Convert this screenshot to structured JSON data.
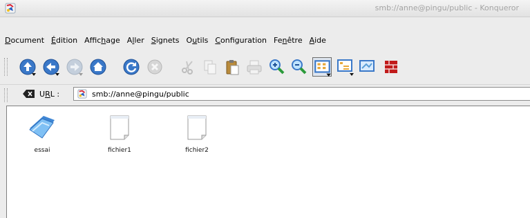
{
  "window": {
    "title": "smb://anne@pingu/public - Konqueror"
  },
  "menubar": {
    "items": [
      {
        "pre": "",
        "u": "D",
        "post": "ocument"
      },
      {
        "pre": "",
        "u": "É",
        "post": "dition"
      },
      {
        "pre": "Affic",
        "u": "h",
        "post": "age"
      },
      {
        "pre": "A",
        "u": "l",
        "post": "ler"
      },
      {
        "pre": "",
        "u": "S",
        "post": "ignets"
      },
      {
        "pre": "O",
        "u": "u",
        "post": "tils"
      },
      {
        "pre": "",
        "u": "C",
        "post": "onfiguration"
      },
      {
        "pre": "Fe",
        "u": "n",
        "post": "être"
      },
      {
        "pre": "",
        "u": "A",
        "post": "ide"
      }
    ]
  },
  "toolbar": {
    "buttons": [
      {
        "icon": "up-arrow-icon",
        "enabled": true
      },
      {
        "icon": "back-arrow-icon",
        "enabled": true
      },
      {
        "icon": "forward-arrow-icon",
        "enabled": false
      },
      {
        "icon": "home-icon",
        "enabled": true
      },
      {
        "icon": "reload-icon",
        "enabled": true
      },
      {
        "icon": "stop-icon",
        "enabled": false
      },
      {
        "icon": "cut-icon",
        "enabled": false
      },
      {
        "icon": "copy-icon",
        "enabled": false
      },
      {
        "icon": "paste-icon",
        "enabled": true
      },
      {
        "icon": "print-icon",
        "enabled": false
      },
      {
        "icon": "zoom-in-icon",
        "enabled": true
      },
      {
        "icon": "zoom-out-icon",
        "enabled": true
      },
      {
        "icon": "icon-view-icon",
        "enabled": true,
        "active": true
      },
      {
        "icon": "tree-view-icon",
        "enabled": true
      },
      {
        "icon": "preview-icon",
        "enabled": true
      },
      {
        "icon": "security-icon",
        "enabled": true
      }
    ]
  },
  "location": {
    "label_pre": "U",
    "label_u": "R",
    "label_post": "L :",
    "url": "smb://anne@pingu/public"
  },
  "files": [
    {
      "name": "essai",
      "type": "folder"
    },
    {
      "name": "fichier1",
      "type": "file"
    },
    {
      "name": "fichier2",
      "type": "file"
    }
  ],
  "colors": {
    "accent_blue": "#3a78c8",
    "folder_blue": "#5ea7ea",
    "title_text": "#a4a4a4"
  }
}
